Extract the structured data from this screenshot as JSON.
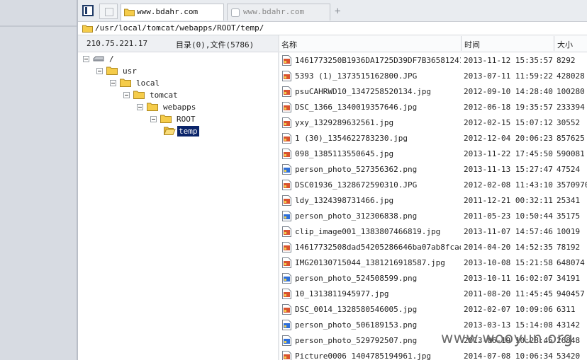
{
  "tabs": [
    {
      "label": "www.bdahr.com",
      "active": true
    },
    {
      "label": "www.bdahr.com",
      "active": false
    }
  ],
  "new_tab_label": "+",
  "address": "/usr/local/tomcat/webapps/ROOT/temp/",
  "status": {
    "ip": "210.75.221.17",
    "counts": "目录(0),文件(5786)"
  },
  "tree": [
    {
      "label": "/",
      "depth": 0,
      "type": "drive"
    },
    {
      "label": "usr",
      "depth": 1,
      "type": "folder"
    },
    {
      "label": "local",
      "depth": 2,
      "type": "folder"
    },
    {
      "label": "tomcat",
      "depth": 3,
      "type": "folder"
    },
    {
      "label": "webapps",
      "depth": 4,
      "type": "folder"
    },
    {
      "label": "ROOT",
      "depth": 5,
      "type": "folder"
    },
    {
      "label": "temp",
      "depth": 6,
      "type": "folder-open",
      "selected": true
    }
  ],
  "columns": {
    "name": "名称",
    "time": "时间",
    "size": "大小"
  },
  "files": [
    {
      "name": "1461773250B1936DA1725D39DF7B36581241...",
      "time": "2013-11-12 15:35:57",
      "size": "8292",
      "kind": "jpg"
    },
    {
      "name": "5393 (1)_1373515162800.JPG",
      "time": "2013-07-11 11:59:22",
      "size": "428028",
      "kind": "jpg"
    },
    {
      "name": "psuCAHRWD10_1347258520134.jpg",
      "time": "2012-09-10 14:28:40",
      "size": "100280",
      "kind": "jpg"
    },
    {
      "name": "DSC_1366_1340019357646.jpg",
      "time": "2012-06-18 19:35:57",
      "size": "233394",
      "kind": "jpg"
    },
    {
      "name": "yxy_1329289632561.jpg",
      "time": "2012-02-15 15:07:12",
      "size": "30552",
      "kind": "jpg"
    },
    {
      "name": "1 (30)_1354622783230.jpg",
      "time": "2012-12-04 20:06:23",
      "size": "857625",
      "kind": "jpg"
    },
    {
      "name": "098_1385113550645.jpg",
      "time": "2013-11-22 17:45:50",
      "size": "590081",
      "kind": "jpg"
    },
    {
      "name": "person_photo_527356362.png",
      "time": "2013-11-13 15:27:47",
      "size": "47524",
      "kind": "png"
    },
    {
      "name": "DSC01936_1328672590310.JPG",
      "time": "2012-02-08 11:43:10",
      "size": "3570970",
      "kind": "jpg"
    },
    {
      "name": "ldy_1324398731466.jpg",
      "time": "2011-12-21 00:32:11",
      "size": "25341",
      "kind": "jpg"
    },
    {
      "name": "person_photo_312306838.png",
      "time": "2011-05-23 10:50:44",
      "size": "35175",
      "kind": "png"
    },
    {
      "name": "clip_image001_1383807466819.jpg",
      "time": "2013-11-07 14:57:46",
      "size": "10019",
      "kind": "jpg"
    },
    {
      "name": "14617732508dad54205286646ba07ab8fcad...",
      "time": "2014-04-20 14:52:35",
      "size": "78192",
      "kind": "jpg"
    },
    {
      "name": "IMG20130715044_1381216918587.jpg",
      "time": "2013-10-08 15:21:58",
      "size": "648074",
      "kind": "jpg"
    },
    {
      "name": "person_photo_524508599.png",
      "time": "2013-10-11 16:02:07",
      "size": "34191",
      "kind": "png"
    },
    {
      "name": "10_1313811945977.jpg",
      "time": "2011-08-20 11:45:45",
      "size": "940457",
      "kind": "jpg"
    },
    {
      "name": "DSC_0014_1328580546005.jpg",
      "time": "2012-02-07 10:09:06",
      "size": "6311",
      "kind": "jpg"
    },
    {
      "name": "person_photo_506189153.png",
      "time": "2013-03-13 15:14:08",
      "size": "43142",
      "kind": "png"
    },
    {
      "name": "person_photo_529792507.png",
      "time": "2013-06-19 10:28:45",
      "size": "26848",
      "kind": "png"
    },
    {
      "name": "Picture0006_1404785194961.jpg",
      "time": "2014-07-08 10:06:34",
      "size": "53420",
      "kind": "jpg"
    }
  ],
  "watermark": "www.wooyun.org",
  "colors": {
    "selection": "#0a246a",
    "folder": "#f5cc4a",
    "jpg_icon": "#d9532f",
    "png_icon": "#2f6fd9"
  }
}
